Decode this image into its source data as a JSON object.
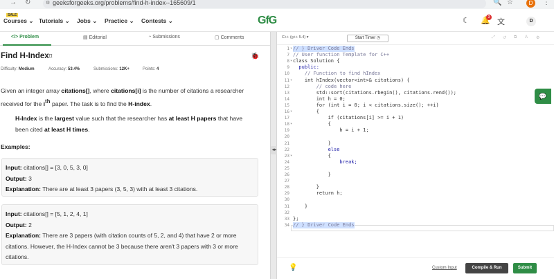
{
  "browser": {
    "url": "geeksforgeeks.org/problems/find-h-index--165609/1",
    "profile_initial": "D"
  },
  "nav": {
    "sale_badge": "SALE",
    "items": [
      "Courses",
      "Tutorials",
      "Jobs",
      "Practice",
      "Contests"
    ],
    "logo": "GfG",
    "notification_count": "3",
    "user_initial": "D"
  },
  "tabs": [
    "Problem",
    "Editorial",
    "Submissions",
    "Comments"
  ],
  "problem": {
    "title": "Find H-Index",
    "difficulty_label": "Difficulty:",
    "difficulty": "Medium",
    "accuracy_label": "Accuracy:",
    "accuracy": "53.4%",
    "submissions_label": "Submissions:",
    "submissions": "12K+",
    "points_label": "Points:",
    "points": "4",
    "desc_1a": "Given an integer array ",
    "desc_1b": "citations[]",
    "desc_1c": ", where ",
    "desc_1d": "citations[i]",
    "desc_1e": " is the number of citations a researcher received for the ",
    "desc_1f": "i",
    "desc_1g": "th",
    "desc_1h": " paper. The task is to find the ",
    "desc_1i": "H-index",
    "desc_1j": ".",
    "desc_2a": "H-Index",
    "desc_2b": " is the ",
    "desc_2c": "largest",
    "desc_2d": " value such that the researcher has ",
    "desc_2e": "at least H papers",
    "desc_2f": " that have been cited ",
    "desc_2g": "at least H times",
    "desc_2h": ".",
    "examples_heading": "Examples:",
    "examples": [
      {
        "input_label": "Input:",
        "input": "citations[] = [3, 0, 5, 3, 0]",
        "output_label": "Output:",
        "output": "3",
        "explanation_label": "Explanation:",
        "explanation": "There are at least 3 papers (3, 5, 3) with at least 3 citations."
      },
      {
        "input_label": "Input:",
        "input": "citations[] = [5, 1, 2, 4, 1]",
        "output_label": "Output:",
        "output": "2",
        "explanation_label": "Explanation:",
        "explanation": "There are 3 papers (with citation counts of 5, 2, and 4) that have 2 or more citations. However, the H-Index cannot be 3 because there aren't 3 papers with 3 or more citations."
      }
    ]
  },
  "editor": {
    "language": "C++ (g++ 5.4)",
    "timer_label": "Start Timer",
    "code_lines": [
      {
        "n": "1",
        "fold": "▾",
        "text": "// } Driver Code Ends",
        "cls": "cm"
      },
      {
        "n": "7",
        "fold": "",
        "text": "// User function Template for C++",
        "cls": "cm"
      },
      {
        "n": "8",
        "fold": "▾",
        "text": "class Solution {",
        "cls": ""
      },
      {
        "n": "9",
        "fold": "",
        "text": "  public:",
        "cls": "kw"
      },
      {
        "n": "10",
        "fold": "",
        "text": "    // Function to find hIndex",
        "cls": "cm"
      },
      {
        "n": "11",
        "fold": "▾",
        "text": "    int hIndex(vector<int>& citations) {",
        "cls": ""
      },
      {
        "n": "12",
        "fold": "",
        "text": "        // code here",
        "cls": "cm"
      },
      {
        "n": "13",
        "fold": "",
        "text": "        std::sort(citations.rbegin(), citations.rend());",
        "cls": ""
      },
      {
        "n": "14",
        "fold": "",
        "text": "        int h = 0;",
        "cls": ""
      },
      {
        "n": "15",
        "fold": "",
        "text": "        for (int i = 0; i < citations.size(); ++i)",
        "cls": ""
      },
      {
        "n": "16",
        "fold": "▾",
        "text": "        {",
        "cls": ""
      },
      {
        "n": "17",
        "fold": "",
        "text": "            if (citations[i] >= i + 1)",
        "cls": ""
      },
      {
        "n": "18",
        "fold": "▾",
        "text": "            {",
        "cls": ""
      },
      {
        "n": "19",
        "fold": "",
        "text": "                h = i + 1;",
        "cls": ""
      },
      {
        "n": "20",
        "fold": "",
        "text": "",
        "cls": ""
      },
      {
        "n": "21",
        "fold": "",
        "text": "            }",
        "cls": ""
      },
      {
        "n": "22",
        "fold": "",
        "text": "            else",
        "cls": "kw"
      },
      {
        "n": "23",
        "fold": "▾",
        "text": "            {",
        "cls": ""
      },
      {
        "n": "24",
        "fold": "",
        "text": "                break;",
        "cls": "kw"
      },
      {
        "n": "25",
        "fold": "",
        "text": "",
        "cls": ""
      },
      {
        "n": "26",
        "fold": "",
        "text": "            }",
        "cls": ""
      },
      {
        "n": "27",
        "fold": "",
        "text": "",
        "cls": ""
      },
      {
        "n": "28",
        "fold": "",
        "text": "        }",
        "cls": ""
      },
      {
        "n": "29",
        "fold": "",
        "text": "        return h;",
        "cls": ""
      },
      {
        "n": "30",
        "fold": "",
        "text": "",
        "cls": ""
      },
      {
        "n": "31",
        "fold": "",
        "text": "    }",
        "cls": ""
      },
      {
        "n": "32",
        "fold": "",
        "text": "",
        "cls": ""
      },
      {
        "n": "33",
        "fold": "",
        "text": "};",
        "cls": ""
      },
      {
        "n": "34",
        "fold": "",
        "text": "// } Driver Code Ends",
        "cls": "cm"
      }
    ],
    "custom_input": "Custom Input",
    "compile_run": "Compile & Run",
    "submit": "Submit"
  }
}
